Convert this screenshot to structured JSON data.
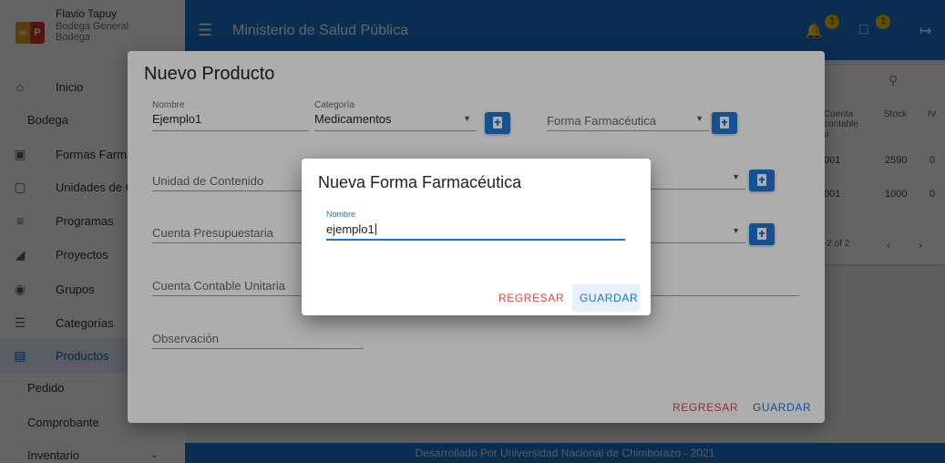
{
  "user": {
    "name": "Flavio Tapuy",
    "role": "Bodega General",
    "area": "Bodega",
    "logo_left": "m",
    "logo_right": "P"
  },
  "sidebar": {
    "items": [
      {
        "label": "Inicio",
        "icon": "home-icon",
        "glyph": "⌂"
      },
      {
        "label": "Bodega"
      },
      {
        "label": "Formas Farmacéuticas",
        "icon": "medkit-icon",
        "glyph": "▣"
      },
      {
        "label": "Unidades de Contenido",
        "icon": "clipboard-icon",
        "glyph": "▢"
      },
      {
        "label": "Programas",
        "icon": "list-icon",
        "glyph": "≡"
      },
      {
        "label": "Proyectos",
        "icon": "projects-icon",
        "glyph": "◢"
      },
      {
        "label": "Grupos",
        "icon": "groups-icon",
        "glyph": "◉"
      },
      {
        "label": "Categorías",
        "icon": "categories-icon",
        "glyph": "☰"
      },
      {
        "label": "Productos",
        "icon": "products-icon",
        "glyph": "▤"
      },
      {
        "label": "Pedido"
      },
      {
        "label": "Comprobante"
      },
      {
        "label": "Inventario"
      }
    ]
  },
  "header": {
    "title": "Ministerio de Salud Pública",
    "bell_badge": "1",
    "calendar_badge": "1"
  },
  "background_table": {
    "headers": [
      "Cuenta contable u",
      "Stock",
      "IV"
    ],
    "rows": [
      {
        "cuenta": "001",
        "stock": "2590",
        "iva": "0"
      },
      {
        "cuenta": "001",
        "stock": "1000",
        "iva": "0"
      }
    ],
    "pagination": "-2 of 2"
  },
  "footer": {
    "text": "Desarrollado Por Universidad Nacional de Chimborazo - 2021"
  },
  "product_dialog": {
    "title": "Nuevo Producto",
    "nombre_label": "Nombre",
    "nombre_value": "Ejemplo1",
    "categoria_label": "Categoría",
    "categoria_value": "Medicamentos",
    "forma_placeholder": "Forma Farmacéutica",
    "unidad_placeholder": "Unidad de Contenido",
    "cuenta_presupuestaria_placeholder": "Cuenta Presupuestaria",
    "cuenta_contable_placeholder": "Cuenta Contable Unitaria",
    "observacion_placeholder": "Observación",
    "back_label": "REGRESAR",
    "save_label": "GUARDAR"
  },
  "form_dialog": {
    "title": "Nueva Forma Farmacéutica",
    "nombre_label": "Nombre",
    "nombre_value": "ejemplo1",
    "back_label": "REGRESAR",
    "save_label": "GUARDAR"
  },
  "colors": {
    "primary": "#1976d2",
    "danger": "#d14b43",
    "badge": "#f6c400"
  }
}
